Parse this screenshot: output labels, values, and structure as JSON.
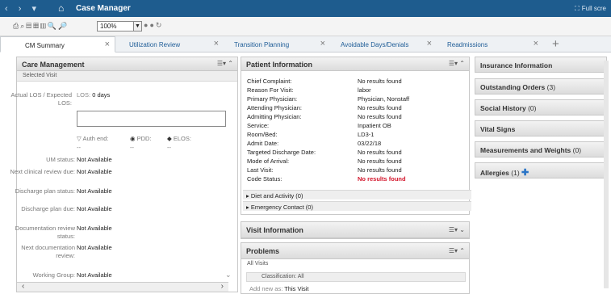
{
  "titlebar": {
    "back_icon": "‹",
    "forward_icon": "›",
    "menu_icon": "▾",
    "home_icon": "⌂",
    "title": "Case Manager",
    "fullscreen_label": "Full scre"
  },
  "toolbar": {
    "zoom_value": "100%"
  },
  "tabs": [
    {
      "label": "CM Summary"
    },
    {
      "label": "Utilization Review"
    },
    {
      "label": "Transition Planning"
    },
    {
      "label": "Avoidable Days/Denials"
    },
    {
      "label": "Readmissions"
    }
  ],
  "care_management": {
    "title": "Care Management",
    "selected_visit": "Selected Visit",
    "los_label": "Actual LOS / Expected LOS:",
    "los_value_label": "LOS:",
    "los_value": "0 days",
    "auth_end_label": "Auth end:",
    "pdd_label": "PDD:",
    "elos_label": "ELOS:",
    "dash": "--",
    "fields": [
      {
        "label": "UM status:",
        "value": "Not Available"
      },
      {
        "label": "Next clinical review due:",
        "value": "Not Available"
      },
      {
        "label": "Discharge plan status:",
        "value": "Not Available"
      },
      {
        "label": "Discharge plan due:",
        "value": "Not Available"
      },
      {
        "label": "Documentation review status:",
        "value": "Not Available"
      },
      {
        "label": "Next documentation review:",
        "value": "Not Available"
      },
      {
        "label": "Working Group:",
        "value": "Not Available"
      }
    ]
  },
  "patient_information": {
    "title": "Patient Information",
    "rows": [
      {
        "label": "Chief Complaint:",
        "value": "No results found"
      },
      {
        "label": "Reason For Visit:",
        "value": "labor"
      },
      {
        "label": "Primary Physician:",
        "value": "Physician, Nonstaff"
      },
      {
        "label": "Attending Physician:",
        "value": "No results found"
      },
      {
        "label": "Admitting Physician:",
        "value": "No results found"
      },
      {
        "label": "Service:",
        "value": "Inpatient OB"
      },
      {
        "label": "Room/Bed:",
        "value": "LD3-1"
      },
      {
        "label": "Admit Date:",
        "value": "03/22/18"
      },
      {
        "label": "Targeted Discharge Date:",
        "value": "No results found"
      },
      {
        "label": "Mode of Arrival:",
        "value": "No results found"
      },
      {
        "label": "Last Visit:",
        "value": "No results found"
      },
      {
        "label": "Code Status:",
        "value": "No results found"
      }
    ],
    "diet": "Diet and Activity (0)",
    "emergency": "Emergency Contact (0)"
  },
  "visit_information": {
    "title": "Visit Information"
  },
  "problems": {
    "title": "Problems",
    "all_visits": "All Visits",
    "classification": "Classification: All",
    "add_new_label": "Add new as:",
    "add_new_value": "This Visit"
  },
  "side_panels": [
    {
      "label": "Insurance Information",
      "count": ""
    },
    {
      "label": "Outstanding Orders",
      "count": "(3)"
    },
    {
      "label": "Social History",
      "count": "(0)"
    },
    {
      "label": "Vital Signs",
      "count": ""
    },
    {
      "label": "Measurements and Weights",
      "count": "(0)"
    },
    {
      "label": "Allergies",
      "count": "(1)"
    }
  ]
}
